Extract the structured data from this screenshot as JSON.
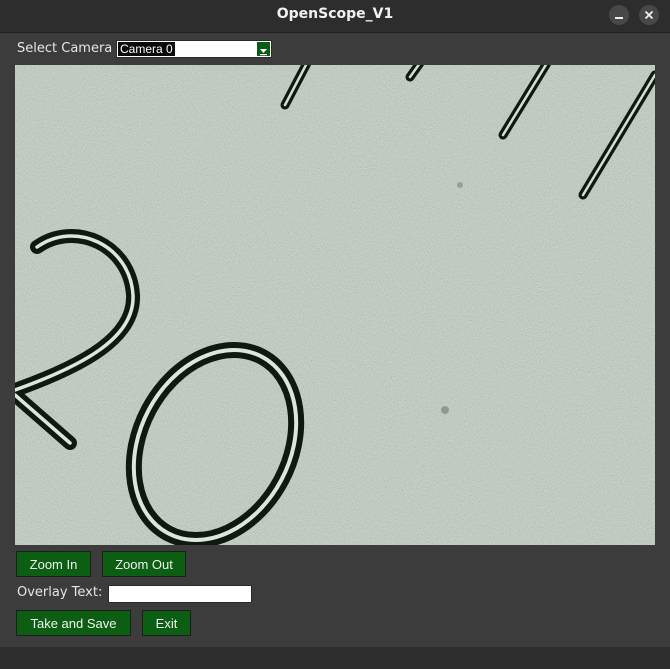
{
  "window": {
    "title": "OpenScope_V1",
    "controls": [
      "minimize-icon",
      "close-icon"
    ]
  },
  "camera": {
    "label": "Select Camera",
    "selected": "Camera 0"
  },
  "preview": {
    "description_icon": "camera-feed",
    "accent_color": "#0b5e12"
  },
  "buttons": {
    "zoom_in": "Zoom In",
    "zoom_out": "Zoom Out",
    "take_and_save": "Take and Save",
    "exit": "Exit"
  },
  "overlay": {
    "label": "Overlay Text:",
    "value": ""
  }
}
